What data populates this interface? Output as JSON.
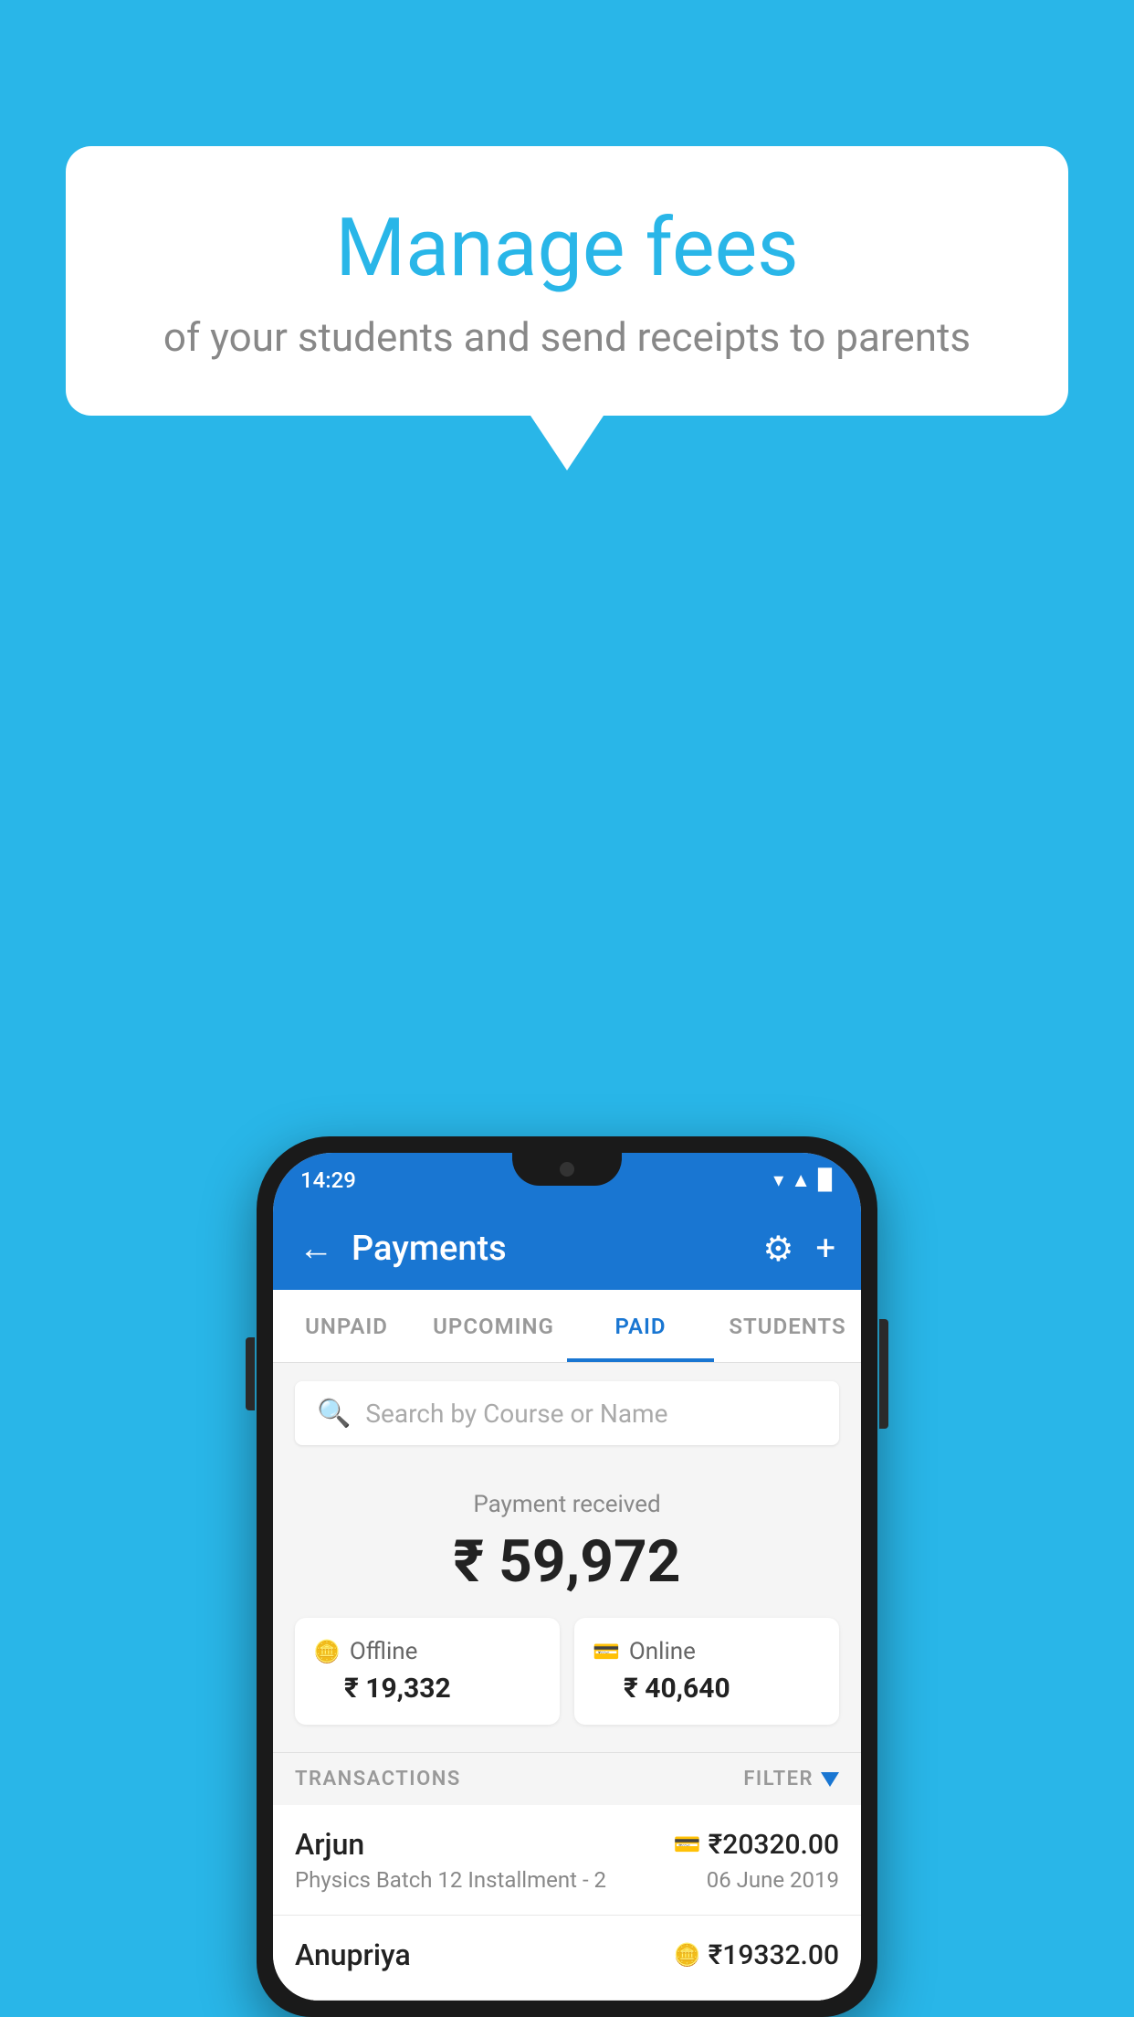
{
  "page": {
    "background_color": "#29b6e8"
  },
  "speech_bubble": {
    "title": "Manage fees",
    "subtitle": "of your students and send receipts to parents"
  },
  "status_bar": {
    "time": "14:29",
    "wifi": "▾",
    "signal": "▲",
    "battery": "▉"
  },
  "top_bar": {
    "back_label": "←",
    "title": "Payments",
    "gear_icon": "⚙",
    "plus_icon": "+"
  },
  "tabs": [
    {
      "label": "UNPAID",
      "active": false
    },
    {
      "label": "UPCOMING",
      "active": false
    },
    {
      "label": "PAID",
      "active": true
    },
    {
      "label": "STUDENTS",
      "active": false
    }
  ],
  "search": {
    "placeholder": "Search by Course or Name"
  },
  "payment_summary": {
    "label": "Payment received",
    "total": "₹ 59,972",
    "offline_label": "Offline",
    "offline_amount": "₹ 19,332",
    "online_label": "Online",
    "online_amount": "₹ 40,640"
  },
  "transactions": {
    "header": "TRANSACTIONS",
    "filter_label": "FILTER",
    "rows": [
      {
        "name": "Arjun",
        "course": "Physics Batch 12 Installment - 2",
        "amount": "₹20320.00",
        "date": "06 June 2019",
        "method": "card"
      },
      {
        "name": "Anupriya",
        "course": "",
        "amount": "₹19332.00",
        "date": "",
        "method": "offline"
      }
    ]
  }
}
